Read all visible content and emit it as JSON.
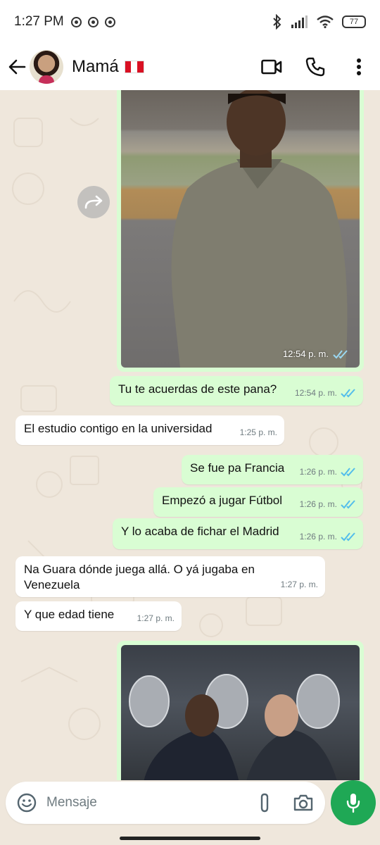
{
  "status_bar": {
    "time": "1:27 PM",
    "battery": "77",
    "icons": [
      "instagram-icon",
      "app-icon",
      "app-icon",
      "bluetooth-icon",
      "signal-icon",
      "wifi-icon",
      "battery-icon"
    ]
  },
  "header": {
    "contact_name": "Mamá",
    "flag": "peru-flag",
    "actions": [
      "video-call-icon",
      "voice-call-icon",
      "more-icon"
    ]
  },
  "messages": [
    {
      "type": "image",
      "direction": "out",
      "time": "12:54 p. m.",
      "status": "read"
    },
    {
      "type": "text",
      "direction": "out",
      "text": "Tu te acuerdas de este pana?",
      "time": "12:54 p. m.",
      "status": "read"
    },
    {
      "type": "text",
      "direction": "in",
      "text": "El estudio contigo en la universidad",
      "time": "1:25 p. m."
    },
    {
      "type": "text",
      "direction": "out",
      "text": "Se fue pa Francia",
      "time": "1:26 p. m.",
      "status": "read"
    },
    {
      "type": "text",
      "direction": "out",
      "text": "Empezó a jugar Fútbol",
      "time": "1:26 p. m.",
      "status": "read"
    },
    {
      "type": "text",
      "direction": "out",
      "text": "Y lo acaba de fichar el Madrid",
      "time": "1:26 p. m.",
      "status": "read"
    },
    {
      "type": "text",
      "direction": "in",
      "text": "Na Guara dónde juega allá. O yá jugaba en Venezuela",
      "time": "1:27 p. m."
    },
    {
      "type": "text",
      "direction": "in",
      "text": "Y que edad tiene",
      "time": "1:27 p. m."
    },
    {
      "type": "image",
      "direction": "out"
    }
  ],
  "input": {
    "placeholder": "Mensaje"
  },
  "colors": {
    "outgoing_bubble": "#d9fdd3",
    "incoming_bubble": "#ffffff",
    "read_ticks": "#53bdeb",
    "mic_button": "#1fa855",
    "wallpaper": "#efe7dc"
  }
}
